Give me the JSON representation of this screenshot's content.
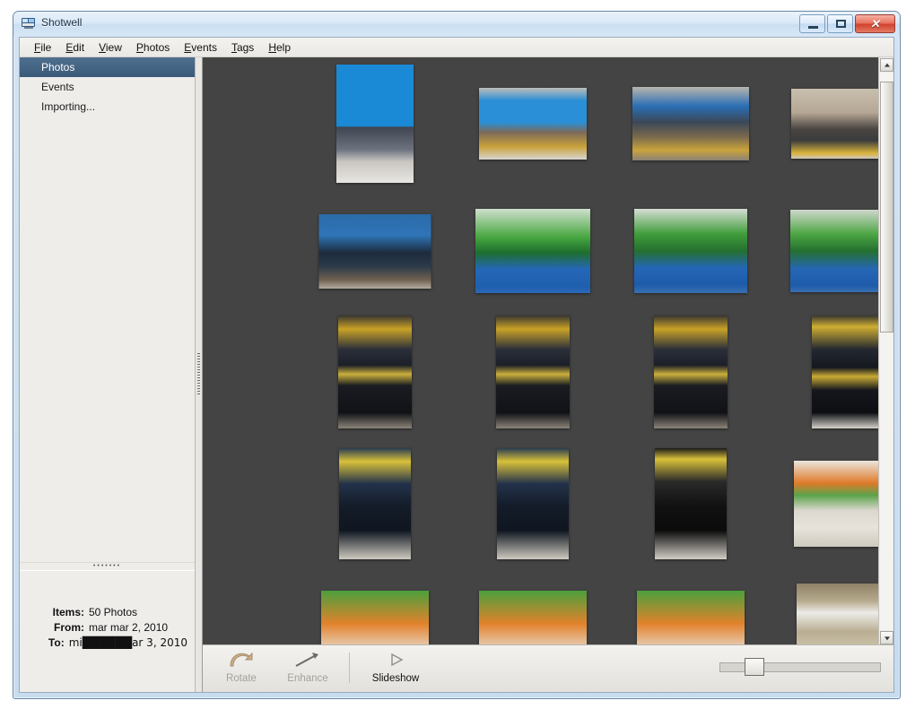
{
  "window": {
    "title": "Shotwell",
    "icon": "shotwell-app-icon",
    "controls": {
      "minimize": "–",
      "maximize": "□",
      "close": "✕"
    }
  },
  "menubar": {
    "items": [
      {
        "label": "File",
        "mnemonic": "F"
      },
      {
        "label": "Edit",
        "mnemonic": "E"
      },
      {
        "label": "View",
        "mnemonic": "V"
      },
      {
        "label": "Photos",
        "mnemonic": "P"
      },
      {
        "label": "Events",
        "mnemonic": "E"
      },
      {
        "label": "Tags",
        "mnemonic": "T"
      },
      {
        "label": "Help",
        "mnemonic": "H"
      }
    ]
  },
  "sidebar": {
    "items": [
      {
        "label": "Photos",
        "selected": true
      },
      {
        "label": "Events",
        "selected": false
      },
      {
        "label": "Importing...",
        "selected": false
      }
    ],
    "status": {
      "rows": [
        {
          "label": "Items:",
          "value": "50 Photos"
        },
        {
          "label": "From:",
          "value": "mar mar 2, 2010"
        },
        {
          "label": "To:",
          "value": "mi██████ar 3, 2010"
        }
      ]
    }
  },
  "toolbar": {
    "rotate": {
      "label": "Rotate",
      "icon": "rotate-icon",
      "enabled": false
    },
    "enhance": {
      "label": "Enhance",
      "icon": "enhance-icon",
      "enabled": false
    },
    "slideshow": {
      "label": "Slideshow",
      "icon": "play-icon",
      "enabled": true
    },
    "zoom_slider": {
      "name": "thumbnail-size-slider",
      "value": 18
    }
  },
  "scrollbar": {
    "vertical": {
      "position_pct": 3,
      "thumb_pct": 45
    }
  },
  "colors": {
    "canvas_bg": "#444444",
    "selection": "#3b5a79",
    "chrome": "#eeedea",
    "frame": "#c8dcee"
  },
  "photos": [
    {
      "row": 1,
      "col": 1,
      "w": 86,
      "h": 132,
      "alt": "man-at-table-blue-backdrop",
      "bg": "linear-gradient(to bottom, #1b8ad6 0%, #1b8ad6 52%, #3f4550 53%, #6d7480 72%, #c9c6c1 82%, #e8e6e2 100%)"
    },
    {
      "row": 1,
      "col": 2,
      "w": 120,
      "h": 80,
      "alt": "softonic-booth-sign",
      "bg": "linear-gradient(to bottom, #bdbcb8 0%, #2a8fd6 18%, #2a8fd6 48%, #7d6a5a 62%, #c8a23a 82%, #d8d5cf 100%)"
    },
    {
      "row": 1,
      "col": 3,
      "w": 130,
      "h": 82,
      "alt": "softonic-booth-crowd",
      "bg": "linear-gradient(to bottom, #b9b5ae 0%, #2a6fb5 26%, #3b4756 48%, #7a6a4d 68%, #c9a33c 86%, #8b8176 100%)"
    },
    {
      "row": 1,
      "col": 4,
      "w": 128,
      "h": 78,
      "alt": "all-about-software-booth",
      "bg": "linear-gradient(to bottom, #c8bfae 0%, #b6a795 34%, #4a4542 58%, #3a3b3d 74%, #d9b33a 92%, #cfc7bb 100%)"
    },
    {
      "row": 2,
      "col": 1,
      "w": 125,
      "h": 83,
      "alt": "booth-with-tv-screen",
      "bg": "linear-gradient(to bottom, #2b6aa8 0%, #2f75b8 28%, #1c2b3c 52%, #2c3a4a 70%, #6f6050 88%, #b3aca0 100%)"
    },
    {
      "row": 2,
      "col": 2,
      "w": 128,
      "h": 94,
      "alt": "green-bicycle-display",
      "bg": "linear-gradient(to bottom, #cfe0cd 0%, #46a63f 34%, #1d6e2e 52%, #2567b8 72%, #1f5fae 92%, #2a68b5 100%)"
    },
    {
      "row": 2,
      "col": 3,
      "w": 126,
      "h": 94,
      "alt": "green-bicycle-closeup",
      "bg": "linear-gradient(to bottom, #d6ded4 0%, #3f9c3a 30%, #24702f 50%, #2566b5 70%, #1e5cab 90%, #3a6fb0 100%)"
    },
    {
      "row": 2,
      "col": 4,
      "w": 130,
      "h": 92,
      "alt": "green-vehicle-wide",
      "bg": "linear-gradient(to bottom, #cfd8cd 0%, #4ba542 30%, #24702f 50%, #2566b5 72%, #1e5cab 92%, #3a6fb0 100%)"
    },
    {
      "row": 3,
      "col": 1,
      "w": 82,
      "h": 126,
      "alt": "man-in-suit-portrait-1",
      "bg": "linear-gradient(to bottom, #3a3730 0%, #c9a227 12%, #2a2f3a 30%, #1c1f27 44%, #cbb03c 52%, #1a1c22 62%, #101216 86%, #8c8478 100%)"
    },
    {
      "row": 3,
      "col": 2,
      "w": 82,
      "h": 126,
      "alt": "man-in-suit-portrait-2",
      "bg": "linear-gradient(to bottom, #3a3730 0%, #c9a227 12%, #2a2f3a 30%, #1c1f27 44%, #cbb03c 52%, #1a1c22 62%, #101216 86%, #8c8478 100%)"
    },
    {
      "row": 3,
      "col": 3,
      "w": 82,
      "h": 126,
      "alt": "man-in-suit-portrait-3",
      "bg": "linear-gradient(to bottom, #3a3730 0%, #c9a227 12%, #2a2f3a 30%, #1c1f27 44%, #cbb03c 52%, #1a1c22 62%, #101216 86%, #8c8478 100%)"
    },
    {
      "row": 3,
      "col": 4,
      "w": 82,
      "h": 126,
      "alt": "man-in-suit-portrait-4",
      "bg": "linear-gradient(to bottom, #3a3730 0%, #cfae32 10%, #232831 30%, #15181e 46%, #c9ab35 54%, #15171c 66%, #0d0f13 86%, #d6d2ca 100%)"
    },
    {
      "row": 4,
      "col": 1,
      "w": 80,
      "h": 124,
      "alt": "man-in-suit-yellow-sign-1",
      "bg": "linear-gradient(to bottom, #2b3c52 0%, #d8c13a 12%, #23324a 32%, #141c29 52%, #0f1620 74%, #cfcac0 100%)"
    },
    {
      "row": 4,
      "col": 2,
      "w": 80,
      "h": 124,
      "alt": "man-in-suit-yellow-sign-2",
      "bg": "linear-gradient(to bottom, #2b3c52 0%, #d8c13a 12%, #23324a 32%, #141c29 52%, #0f1620 74%, #cfcac0 100%)"
    },
    {
      "row": 4,
      "col": 3,
      "w": 80,
      "h": 124,
      "alt": "man-in-suit-yellow-sign-3",
      "bg": "linear-gradient(to bottom, #1a1a1a 0%, #d8c13a 10%, #2a2a2a 30%, #111111 52%, #0b0b0b 74%, #d2cec6 100%)"
    },
    {
      "row": 4,
      "col": 4,
      "w": 122,
      "h": 96,
      "alt": "two-men-joomla-backdrop",
      "bg": "linear-gradient(to bottom, #eae6dd 0%, #e07a2a 26%, #5aa34a 40%, #dcd8cf 58%, #e7e3da 78%, #cfcabf 100%)"
    },
    {
      "row": 5,
      "col": 1,
      "w": 120,
      "h": 80,
      "alt": "orange-green-banner-1",
      "bg": "linear-gradient(to bottom, #4ba03c 0%, #e2822c 46%, #e8e4db 88%, #d6d2c9 100%)"
    },
    {
      "row": 5,
      "col": 2,
      "w": 120,
      "h": 80,
      "alt": "orange-green-banner-2",
      "bg": "linear-gradient(to bottom, #4ba03c 0%, #e2822c 46%, #e8e4db 88%, #d6d2c9 100%)"
    },
    {
      "row": 5,
      "col": 3,
      "w": 120,
      "h": 80,
      "alt": "orange-green-banner-3",
      "bg": "linear-gradient(to bottom, #4ba03c 0%, #e2822c 46%, #e8e4db 88%, #d6d2c9 100%)"
    },
    {
      "row": 5,
      "col": 4,
      "w": 116,
      "h": 96,
      "alt": "joomla-banner-booth",
      "bg": "linear-gradient(to bottom, #8e8268 0%, #b6a98c 20%, #ecebe7 34%, #b9ae92 56%, #cfc6ad 78%, #a79c80 100%)"
    }
  ]
}
